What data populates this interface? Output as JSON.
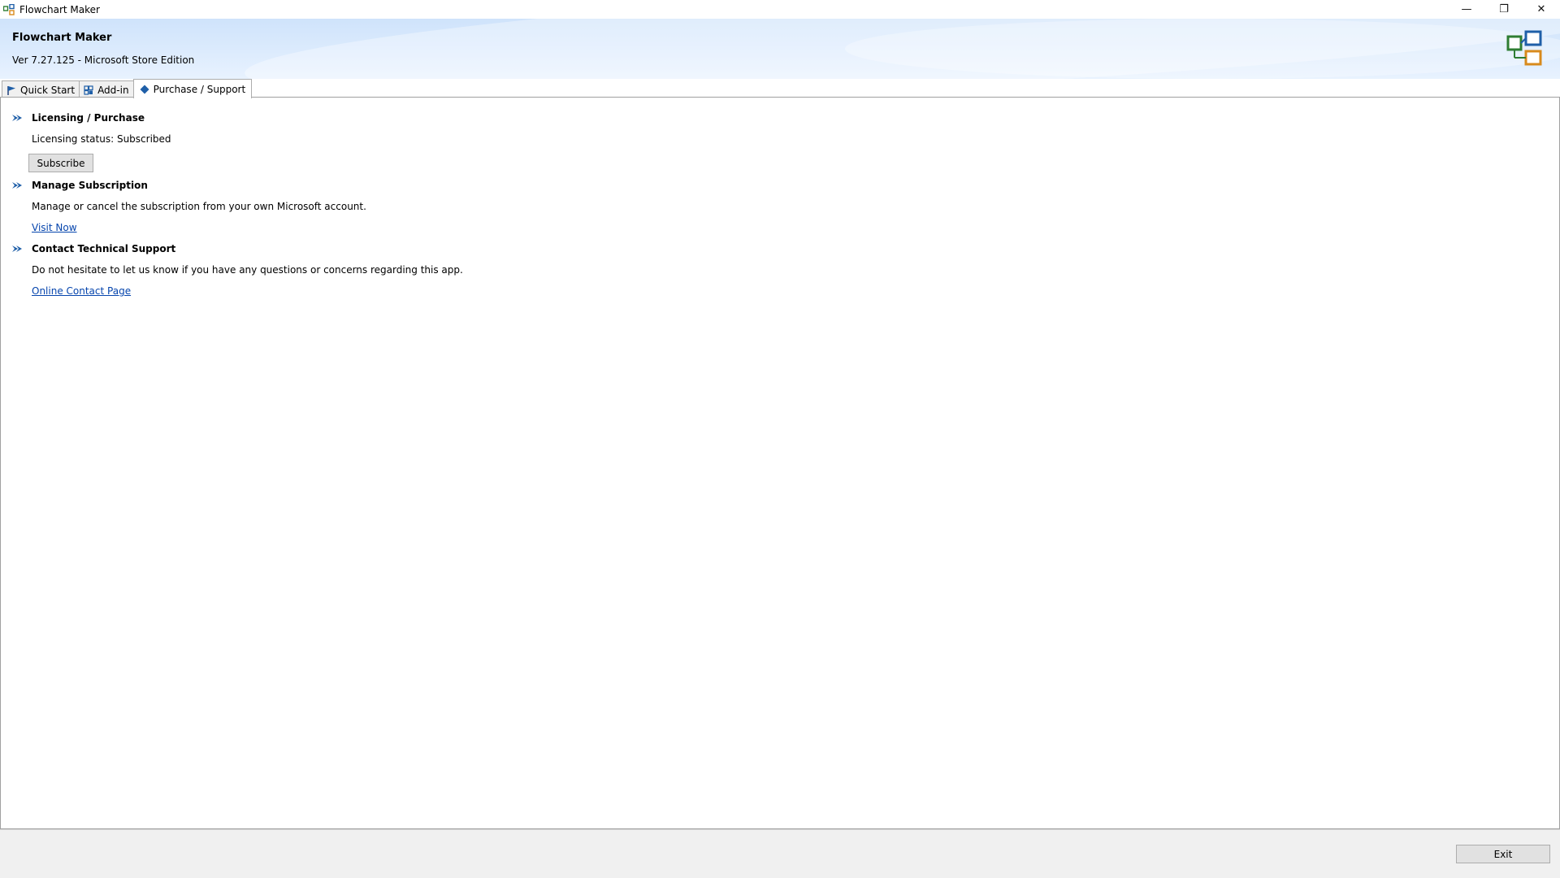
{
  "window": {
    "title": "Flowchart Maker",
    "controls": {
      "minimize": "—",
      "restore": "❐",
      "close": "✕"
    }
  },
  "header": {
    "app_name": "Flowchart Maker",
    "version": "Ver 7.27.125 - Microsoft Store Edition",
    "logo_icon": "flowchart-logo-icon"
  },
  "tabs": [
    {
      "label": "Quick Start",
      "icon": "flag-icon",
      "active": false
    },
    {
      "label": "Add-in",
      "icon": "add-in-icon",
      "active": false
    },
    {
      "label": "Purchase / Support",
      "icon": "diamond-icon",
      "active": true
    }
  ],
  "sections": {
    "licensing": {
      "title": "Licensing / Purchase",
      "status": "Licensing status: Subscribed",
      "button": "Subscribe"
    },
    "subscription": {
      "title": "Manage Subscription",
      "text": "Manage or cancel the subscription from your own Microsoft account.",
      "link": "Visit Now"
    },
    "support": {
      "title": "Contact Technical Support",
      "text": "Do not hesitate to let us know if you have any questions or concerns regarding this app.",
      "link": "Online Contact Page"
    }
  },
  "footer": {
    "exit_label": "Exit"
  },
  "colors": {
    "accent": "#1f5fa8",
    "link": "#0645ad",
    "header_top": "#cfe3fb"
  }
}
